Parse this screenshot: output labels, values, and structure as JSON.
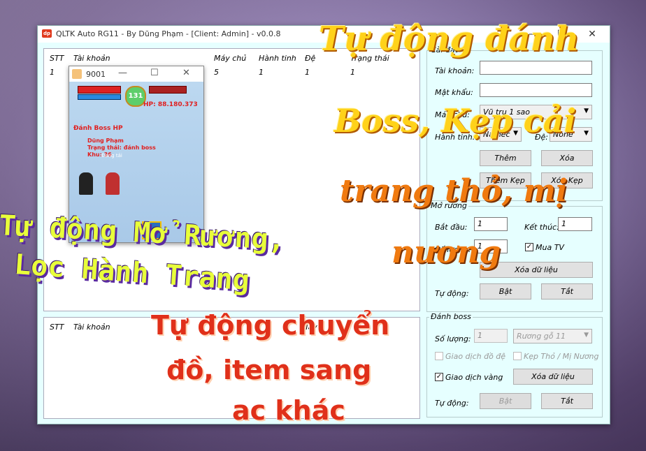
{
  "window": {
    "title": "QLTK Auto RG11 - By Dũng Phạm - [Client: Admin] - v0.0.8",
    "logo": "dp",
    "minimize": "—",
    "maximize": "☐",
    "close": "✕"
  },
  "accounts_table": {
    "headers": [
      "STT",
      "Tài khoản",
      "Máy chủ",
      "Hành tinh",
      "Đệ",
      "Trạng thái"
    ],
    "rows": [
      {
        "stt": "1",
        "may_chu": "5",
        "hanh_tinh": "1",
        "de": "1",
        "trang_thai": "1"
      }
    ]
  },
  "transfer_table": {
    "headers": [
      "STT",
      "Tài khoản",
      "Máy"
    ]
  },
  "settings": {
    "group_label": "Cài đặt",
    "account_label": "Tài khoản:",
    "password_label": "Mật khẩu:",
    "server_label": "Máy chủ:",
    "server_value": "Vũ trụ 1 sao",
    "planet_label": "Hành tinh:",
    "planet_value": "Namec",
    "pet_label": "Đệ:",
    "pet_value": "None",
    "add_button": "Thêm",
    "delete_button": "Xóa",
    "add_kep_button": "Thêm Kẹp",
    "delete_kep_button": "Xóa Kẹp"
  },
  "open_chest": {
    "group_label": "Mở rương",
    "start_label": "Bắt đầu:",
    "start_value": "1",
    "end_label": "Kết thúc:",
    "end_value": "1",
    "count_label": "Số lượng:",
    "count_value": "1",
    "buy_tv_label": "Mua TV",
    "buy_tv_checked": "✓",
    "data_button": "Xóa dữ liệu",
    "auto_label": "Tự động:",
    "on_button": "Bật",
    "off_button": "Tắt"
  },
  "boss": {
    "group_label": "Đánh boss",
    "count_label": "Số lượng:",
    "count_value": "1",
    "chest_value": "Rương gỗ 11",
    "trade_item_label": "Giao dịch đồ đệ",
    "clip_label": "Kẹp Thỏ / Mị Nương",
    "trade_gold_label": "Giao dịch vàng",
    "trade_gold_checked": "✓",
    "clear_button": "Xóa dữ liệu",
    "auto_label": "Tự động:",
    "on_button": "Bật",
    "off_button": "Tắt"
  },
  "game_window": {
    "title": "9001",
    "level": "131",
    "hp_text": "HP: 88.180.373",
    "status_line1": "Đánh Boss HP",
    "status_line2": "Dũng Phạm",
    "status_line3": "Trạng thái: đánh boss",
    "status_line4": "Khu: 36",
    "status_line5": "Đang tải"
  },
  "overlay": {
    "line_a1": "Tự động đánh",
    "line_a2": "Boss, Kẹp cải",
    "line_a3": "trang thỏ, mị",
    "line_a4": "nương",
    "line_b1": "Tự động Mở Rương,",
    "line_b2": "Lọc Hành Trang",
    "line_c1": "Tự động chuyển",
    "line_c2": "đồ, item sang",
    "line_c3": "ac khác"
  }
}
